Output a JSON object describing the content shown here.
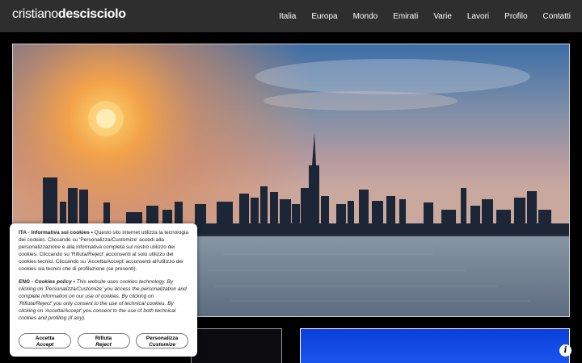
{
  "header": {
    "logo_light": "cristiano",
    "logo_bold": "descisciolo",
    "nav": [
      "Italia",
      "Europa",
      "Mondo",
      "Emirati",
      "Varie",
      "Lavori",
      "Profilo",
      "Contatti"
    ]
  },
  "hero": {
    "description": "sunset skyline photo"
  },
  "cookie": {
    "ita_title": "ITA - Informativa sui cookies",
    "ita_sep": " • ",
    "ita_text": "Questo sito internet utilizza la tecnologia dei cookies. Cliccando su 'Personalizza/Customize' accedi alla personalizzazione e alla informativa completa sul nostro utilizzo dei cookies. Cliccando su 'Rifiuta/Reject' acconsenti al solo utilizzo dei cookies tecnici. Cliccando su 'Accetta/Accept' acconsenti all'utilizzo dei cookies sia tecnici che di profilazione (se presenti).",
    "eng_title": "ENG - Cookies policy",
    "eng_sep": " • ",
    "eng_text": "This website uses cookies technology. By clicking on 'Personalizza/Customize' you access the personalization and complete information on our use of cookies. By clicking on 'Rifiuta/Reject' you only consent to the use of technical cookies. By clicking on 'Accetta/Accept' you consent to the use of both technical cookies and profiling (if any).",
    "buttons": [
      {
        "l1": "Accetta",
        "l2": "Accept"
      },
      {
        "l1": "Rifiuta",
        "l2": "Reject"
      },
      {
        "l1": "Personalizza",
        "l2": "Customize"
      }
    ]
  },
  "info_button": {
    "label": "i"
  },
  "colors": {
    "topbar": "#2e2e2e",
    "sky_top": "#3f6fa8",
    "sun": "#fff4c0",
    "water": "#6f8296"
  }
}
